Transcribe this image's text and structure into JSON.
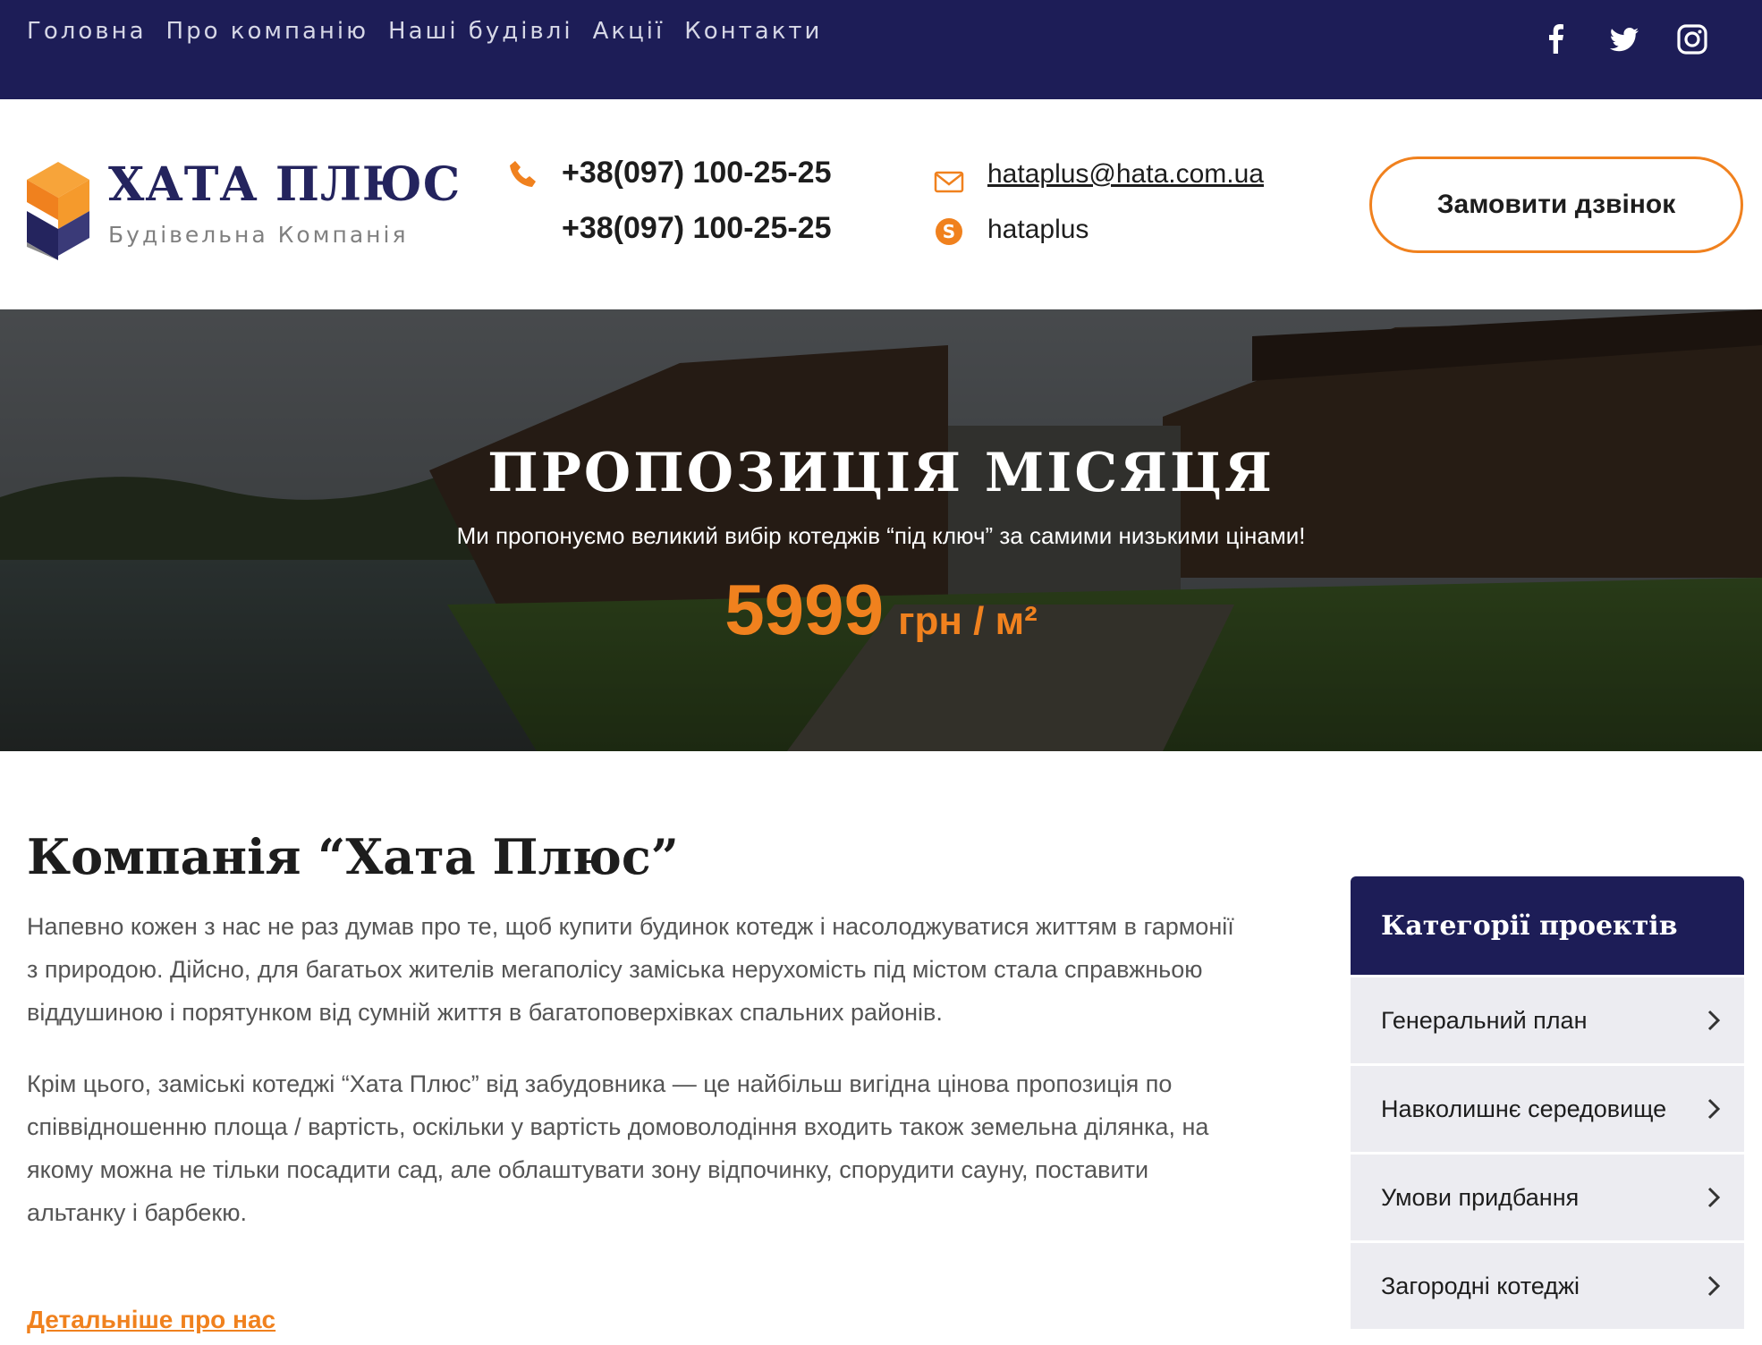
{
  "topnav": {
    "items": [
      {
        "label": "Головна"
      },
      {
        "label": "Про компанію"
      },
      {
        "label": "Наші будівлі"
      },
      {
        "label": "Акції"
      },
      {
        "label": "Контакти"
      }
    ],
    "social": [
      "facebook-icon",
      "twitter-icon",
      "instagram-icon"
    ]
  },
  "header": {
    "logo_title": "ХАТА ПЛЮС",
    "logo_subtitle": "Будівельна Компанія",
    "phone_1": "+38(097) 100-25-25",
    "phone_2": "+38(097) 100-25-25",
    "email": "hataplus@hata.com.ua",
    "skype": "hataplus",
    "call_button": "Замовити дзвінок"
  },
  "hero": {
    "title": "ПРОПОЗИЦІЯ МІСЯЦЯ",
    "subtitle": "Ми пропонуємо великий вибір котеджів “під ключ” за самими низькими цінами!",
    "price": "5999",
    "unit": "грн / м²"
  },
  "main": {
    "heading": "Компанія “Хата Плюс”",
    "paragraph_1": "Напевно кожен з нас не раз думав про те, щоб купити будинок котедж і насолоджуватися життям в гармонії з природою. Дійсно, для багатьох жителів мегаполісу заміська нерухомість під містом стала справжньою віддушиною і порятунком від сумній життя в багатоповерхівках спальних районів.",
    "paragraph_2": "Крім цього, заміські котеджі “Хата Плюс” від забудовника — це найбільш вигідна цінова пропозиція по співвідношенню площа / вартість, оскільки у вартість домоволодіння входить також земельна ділянка, на якому можна не тільки посадити сад, але облаштувати зону відпочинку, спорудити сауну, поставити альтанку і барбекю.",
    "more_link": "Детальніше про нас"
  },
  "sidebar": {
    "title": "Категорії проектів",
    "items": [
      {
        "label": "Генеральний план"
      },
      {
        "label": "Навколишнє середовище"
      },
      {
        "label": "Умови придбання"
      },
      {
        "label": "Загородні котеджі"
      }
    ]
  },
  "colors": {
    "navy": "#1d1d57",
    "accent": "#f0811e"
  }
}
